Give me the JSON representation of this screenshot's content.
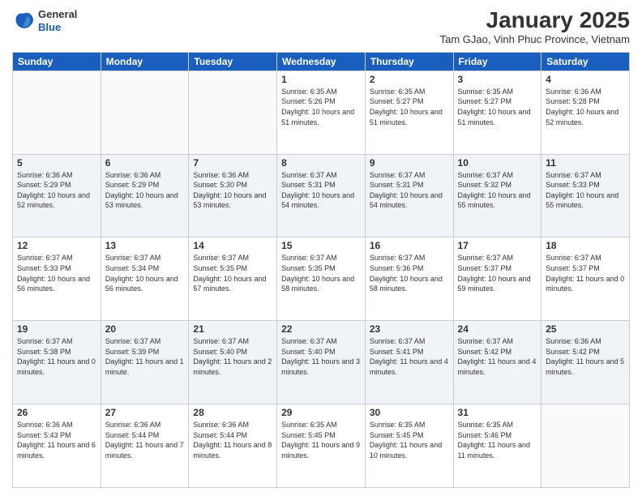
{
  "logo": {
    "general": "General",
    "blue": "Blue"
  },
  "header": {
    "title": "January 2025",
    "subtitle": "Tam GJao, Vinh Phuc Province, Vietnam"
  },
  "weekdays": [
    "Sunday",
    "Monday",
    "Tuesday",
    "Wednesday",
    "Thursday",
    "Friday",
    "Saturday"
  ],
  "weeks": [
    [
      {
        "day": "",
        "sunrise": "",
        "sunset": "",
        "daylight": ""
      },
      {
        "day": "",
        "sunrise": "",
        "sunset": "",
        "daylight": ""
      },
      {
        "day": "",
        "sunrise": "",
        "sunset": "",
        "daylight": ""
      },
      {
        "day": "1",
        "sunrise": "Sunrise: 6:35 AM",
        "sunset": "Sunset: 5:26 PM",
        "daylight": "Daylight: 10 hours and 51 minutes."
      },
      {
        "day": "2",
        "sunrise": "Sunrise: 6:35 AM",
        "sunset": "Sunset: 5:27 PM",
        "daylight": "Daylight: 10 hours and 51 minutes."
      },
      {
        "day": "3",
        "sunrise": "Sunrise: 6:35 AM",
        "sunset": "Sunset: 5:27 PM",
        "daylight": "Daylight: 10 hours and 51 minutes."
      },
      {
        "day": "4",
        "sunrise": "Sunrise: 6:36 AM",
        "sunset": "Sunset: 5:28 PM",
        "daylight": "Daylight: 10 hours and 52 minutes."
      }
    ],
    [
      {
        "day": "5",
        "sunrise": "Sunrise: 6:36 AM",
        "sunset": "Sunset: 5:29 PM",
        "daylight": "Daylight: 10 hours and 52 minutes."
      },
      {
        "day": "6",
        "sunrise": "Sunrise: 6:36 AM",
        "sunset": "Sunset: 5:29 PM",
        "daylight": "Daylight: 10 hours and 53 minutes."
      },
      {
        "day": "7",
        "sunrise": "Sunrise: 6:36 AM",
        "sunset": "Sunset: 5:30 PM",
        "daylight": "Daylight: 10 hours and 53 minutes."
      },
      {
        "day": "8",
        "sunrise": "Sunrise: 6:37 AM",
        "sunset": "Sunset: 5:31 PM",
        "daylight": "Daylight: 10 hours and 54 minutes."
      },
      {
        "day": "9",
        "sunrise": "Sunrise: 6:37 AM",
        "sunset": "Sunset: 5:31 PM",
        "daylight": "Daylight: 10 hours and 54 minutes."
      },
      {
        "day": "10",
        "sunrise": "Sunrise: 6:37 AM",
        "sunset": "Sunset: 5:32 PM",
        "daylight": "Daylight: 10 hours and 55 minutes."
      },
      {
        "day": "11",
        "sunrise": "Sunrise: 6:37 AM",
        "sunset": "Sunset: 5:33 PM",
        "daylight": "Daylight: 10 hours and 55 minutes."
      }
    ],
    [
      {
        "day": "12",
        "sunrise": "Sunrise: 6:37 AM",
        "sunset": "Sunset: 5:33 PM",
        "daylight": "Daylight: 10 hours and 56 minutes."
      },
      {
        "day": "13",
        "sunrise": "Sunrise: 6:37 AM",
        "sunset": "Sunset: 5:34 PM",
        "daylight": "Daylight: 10 hours and 56 minutes."
      },
      {
        "day": "14",
        "sunrise": "Sunrise: 6:37 AM",
        "sunset": "Sunset: 5:35 PM",
        "daylight": "Daylight: 10 hours and 57 minutes."
      },
      {
        "day": "15",
        "sunrise": "Sunrise: 6:37 AM",
        "sunset": "Sunset: 5:35 PM",
        "daylight": "Daylight: 10 hours and 58 minutes."
      },
      {
        "day": "16",
        "sunrise": "Sunrise: 6:37 AM",
        "sunset": "Sunset: 5:36 PM",
        "daylight": "Daylight: 10 hours and 58 minutes."
      },
      {
        "day": "17",
        "sunrise": "Sunrise: 6:37 AM",
        "sunset": "Sunset: 5:37 PM",
        "daylight": "Daylight: 10 hours and 59 minutes."
      },
      {
        "day": "18",
        "sunrise": "Sunrise: 6:37 AM",
        "sunset": "Sunset: 5:37 PM",
        "daylight": "Daylight: 11 hours and 0 minutes."
      }
    ],
    [
      {
        "day": "19",
        "sunrise": "Sunrise: 6:37 AM",
        "sunset": "Sunset: 5:38 PM",
        "daylight": "Daylight: 11 hours and 0 minutes."
      },
      {
        "day": "20",
        "sunrise": "Sunrise: 6:37 AM",
        "sunset": "Sunset: 5:39 PM",
        "daylight": "Daylight: 11 hours and 1 minute."
      },
      {
        "day": "21",
        "sunrise": "Sunrise: 6:37 AM",
        "sunset": "Sunset: 5:40 PM",
        "daylight": "Daylight: 11 hours and 2 minutes."
      },
      {
        "day": "22",
        "sunrise": "Sunrise: 6:37 AM",
        "sunset": "Sunset: 5:40 PM",
        "daylight": "Daylight: 11 hours and 3 minutes."
      },
      {
        "day": "23",
        "sunrise": "Sunrise: 6:37 AM",
        "sunset": "Sunset: 5:41 PM",
        "daylight": "Daylight: 11 hours and 4 minutes."
      },
      {
        "day": "24",
        "sunrise": "Sunrise: 6:37 AM",
        "sunset": "Sunset: 5:42 PM",
        "daylight": "Daylight: 11 hours and 4 minutes."
      },
      {
        "day": "25",
        "sunrise": "Sunrise: 6:36 AM",
        "sunset": "Sunset: 5:42 PM",
        "daylight": "Daylight: 11 hours and 5 minutes."
      }
    ],
    [
      {
        "day": "26",
        "sunrise": "Sunrise: 6:36 AM",
        "sunset": "Sunset: 5:43 PM",
        "daylight": "Daylight: 11 hours and 6 minutes."
      },
      {
        "day": "27",
        "sunrise": "Sunrise: 6:36 AM",
        "sunset": "Sunset: 5:44 PM",
        "daylight": "Daylight: 11 hours and 7 minutes."
      },
      {
        "day": "28",
        "sunrise": "Sunrise: 6:36 AM",
        "sunset": "Sunset: 5:44 PM",
        "daylight": "Daylight: 11 hours and 8 minutes."
      },
      {
        "day": "29",
        "sunrise": "Sunrise: 6:35 AM",
        "sunset": "Sunset: 5:45 PM",
        "daylight": "Daylight: 11 hours and 9 minutes."
      },
      {
        "day": "30",
        "sunrise": "Sunrise: 6:35 AM",
        "sunset": "Sunset: 5:45 PM",
        "daylight": "Daylight: 11 hours and 10 minutes."
      },
      {
        "day": "31",
        "sunrise": "Sunrise: 6:35 AM",
        "sunset": "Sunset: 5:46 PM",
        "daylight": "Daylight: 11 hours and 11 minutes."
      },
      {
        "day": "",
        "sunrise": "",
        "sunset": "",
        "daylight": ""
      }
    ]
  ]
}
